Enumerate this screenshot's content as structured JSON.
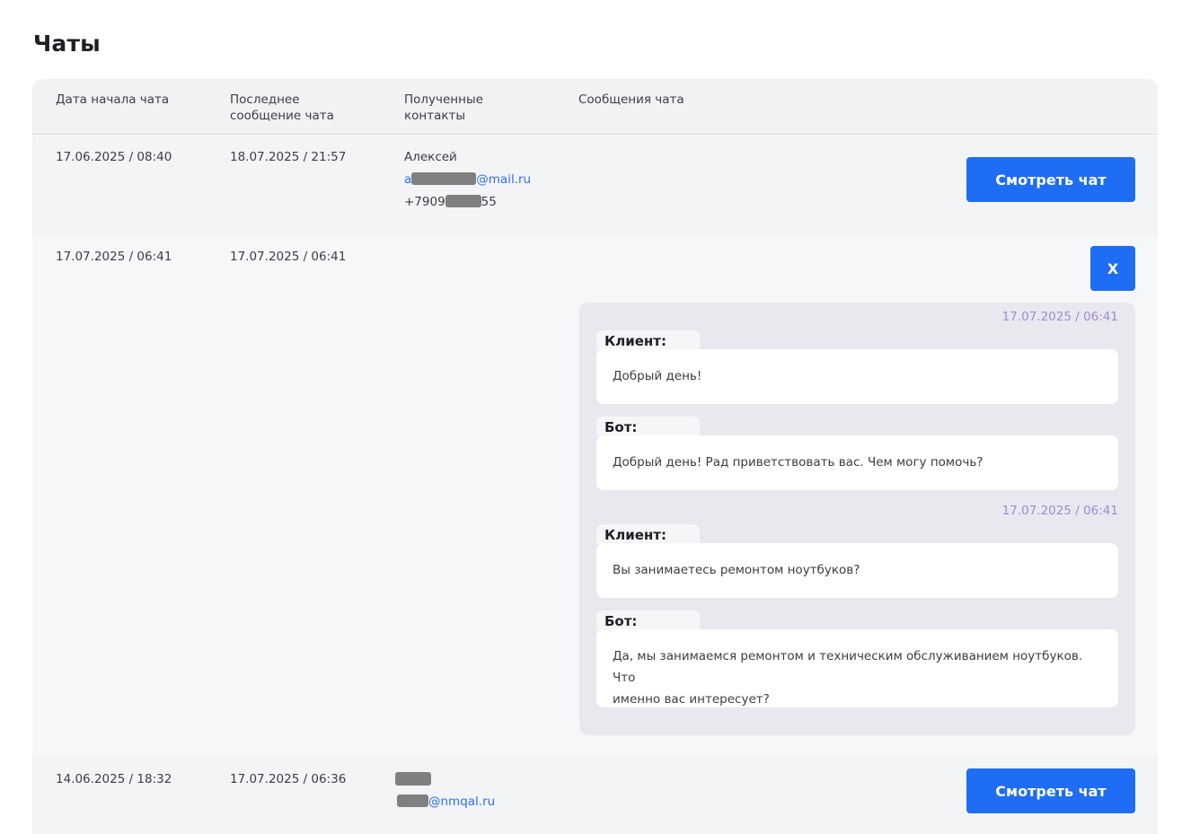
{
  "page": {
    "title": "Чаты"
  },
  "table": {
    "headers": {
      "start_date": "Дата начала чата",
      "last_message_line1": "Последнее",
      "last_message_line2": "сообщение чата",
      "contacts_line1": "Полученные",
      "contacts_line2": "контакты",
      "messages": "Сообщения чата"
    },
    "rows": [
      {
        "start": "17.06.2025 / 08:40",
        "last": "18.07.2025 / 21:57",
        "contact_name": "Алексей",
        "email_prefix": "a",
        "email_suffix": "@mail.ru",
        "phone_prefix": "+7909",
        "phone_suffix": "55",
        "button": "Смотреть чат"
      },
      {
        "start": "17.07.2025 / 06:41",
        "last": "17.07.2025 / 06:41",
        "close_button": "X"
      },
      {
        "start": "14.06.2025 / 18:32",
        "last": "17.07.2025 / 06:36",
        "email_suffix": "@nmqal.ru",
        "button": "Смотреть чат"
      }
    ]
  },
  "chat": {
    "timestamp_1": "17.07.2025 / 06:41",
    "timestamp_2": "17.07.2025 / 06:41",
    "client_label": "Клиент:",
    "bot_label": "Бот:",
    "messages": [
      {
        "speaker": "Клиент:",
        "text": "Добрый день!"
      },
      {
        "speaker": "Бот:",
        "text": "Добрый день! Рад приветствовать вас. Чем могу помочь?"
      },
      {
        "speaker": "Клиент:",
        "text": "Вы занимаетесь ремонтом ноутбуков?"
      },
      {
        "speaker": "Бот:",
        "text_line1": "Да, мы занимаемся ремонтом и техническим обслуживанием ноутбуков. Что",
        "text_line2": "именно вас интересует?"
      }
    ]
  },
  "colors": {
    "accent": "#1f6df5",
    "link": "#2b6ff5",
    "timestamp": "#a08ad6",
    "panel": "#e8e9ee"
  }
}
